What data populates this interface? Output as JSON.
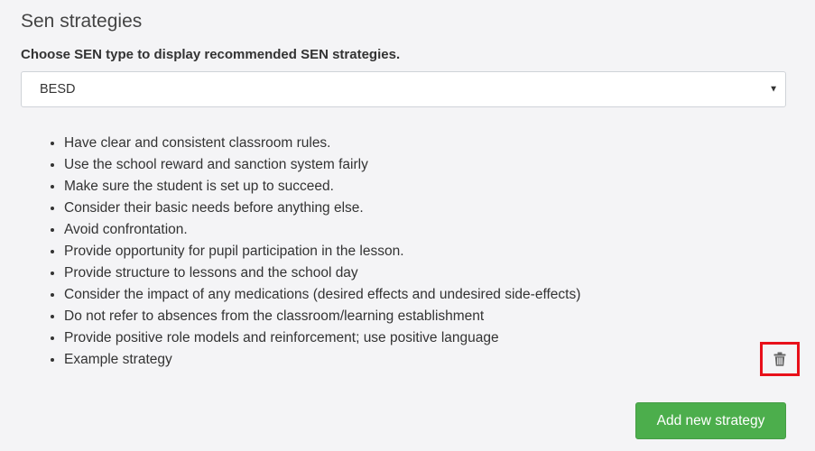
{
  "section": {
    "title": "Sen strategies",
    "prompt": "Choose SEN type to display recommended SEN strategies."
  },
  "sen_type_select": {
    "selected": "BESD",
    "caret_icon": "caret-down-icon"
  },
  "strategies": [
    "Have clear and consistent classroom rules.",
    "Use the school reward and sanction system fairly",
    "Make sure the student is set up to succeed.",
    "Consider their basic needs before anything else.",
    "Avoid confrontation.",
    "Provide opportunity for pupil participation in the lesson.",
    "Provide structure to lessons and the school day",
    "Consider the impact of any medications (desired effects and undesired side-effects)",
    "Do not refer to absences from the classroom/learning establishment",
    "Provide positive role models and reinforcement; use positive language",
    "Example strategy"
  ],
  "delete_action": {
    "icon": "trash-icon",
    "highlight_color": "#e8101a",
    "icon_color": "#666666"
  },
  "actions": {
    "add_label": "Add new strategy",
    "add_color": "#4cae4c"
  }
}
